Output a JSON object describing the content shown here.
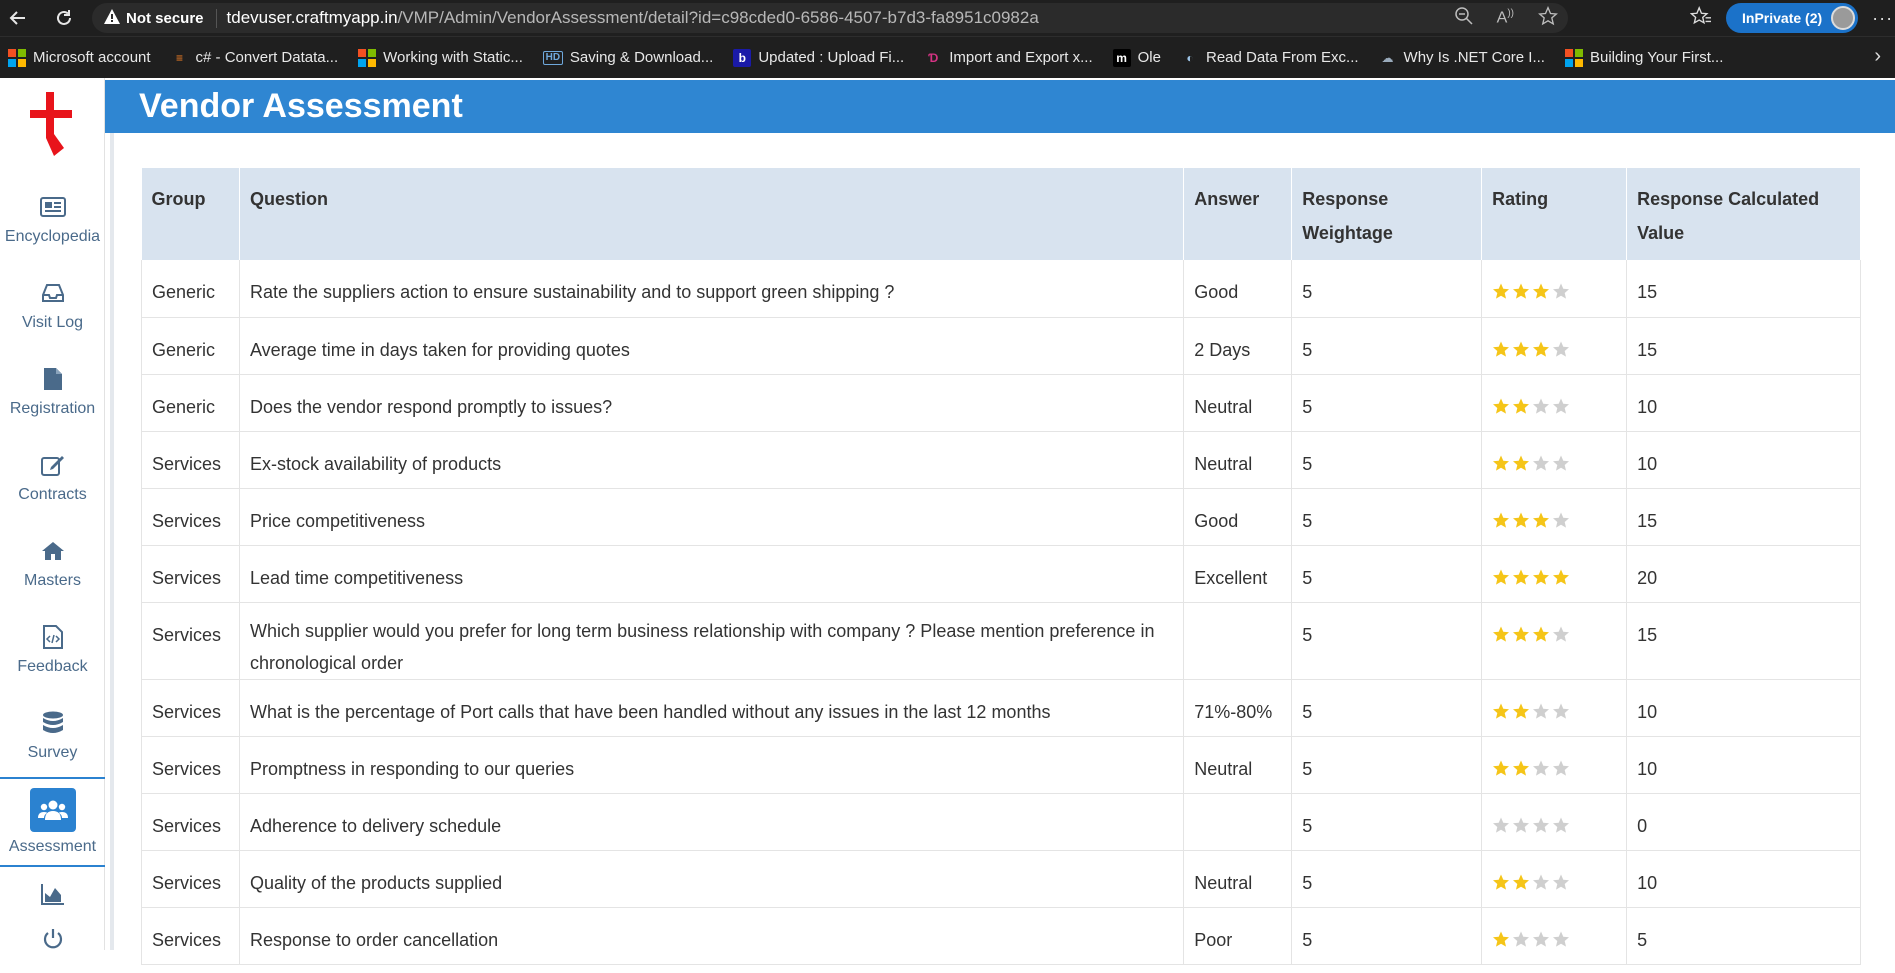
{
  "browser": {
    "not_secure": "Not secure",
    "url_host": "tdevuser.craftmyapp.in",
    "url_path": "/VMP/Admin/VendorAssessment/detail?id=c98cded0-6586-4507-b7d3-fa8951c0982a",
    "profile_label": "InPrivate (2)",
    "bookmarks": [
      {
        "label": "Microsoft account",
        "icon": "microsoft-icon"
      },
      {
        "label": "c# - Convert Datata...",
        "icon": "stackoverflow-icon"
      },
      {
        "label": "Working with Static...",
        "icon": "microsoft-icon"
      },
      {
        "label": "Saving & Download...",
        "icon": "hd-icon"
      },
      {
        "label": "Updated : Upload Fi...",
        "icon": "b-icon"
      },
      {
        "label": "Import and Export x...",
        "icon": "d-icon"
      },
      {
        "label": "Ole",
        "icon": "m-icon"
      },
      {
        "label": "Read Data From Exc...",
        "icon": "globe-icon"
      },
      {
        "label": "Why Is .NET Core I...",
        "icon": "cloud-icon"
      },
      {
        "label": "Building Your First...",
        "icon": "microsoft-icon"
      }
    ]
  },
  "sidebar": {
    "items": [
      {
        "label": "Encyclopedia",
        "icon": "newspaper-icon"
      },
      {
        "label": "Visit Log",
        "icon": "inbox-icon"
      },
      {
        "label": "Registration",
        "icon": "file-icon"
      },
      {
        "label": "Contracts",
        "icon": "edit-icon"
      },
      {
        "label": "Masters",
        "icon": "home-icon"
      },
      {
        "label": "Feedback",
        "icon": "code-file-icon"
      },
      {
        "label": "Survey",
        "icon": "database-icon"
      },
      {
        "label": "Assessment",
        "icon": "users-icon"
      }
    ],
    "active": "Assessment"
  },
  "header": {
    "title": "Vendor Assessment"
  },
  "table": {
    "columns": [
      "Group",
      "Question",
      "Answer",
      "Response Weightage",
      "Rating",
      "Response Calculated Value"
    ],
    "rows": [
      {
        "group": "Generic",
        "question": "Rate the suppliers action to ensure sustainability and to support green shipping ?",
        "answer": "Good",
        "weightage": "5",
        "rating": 3,
        "value": "15"
      },
      {
        "group": "Generic",
        "question": "Average time in days taken for providing quotes",
        "answer": "2 Days",
        "weightage": "5",
        "rating": 3,
        "value": "15"
      },
      {
        "group": "Generic",
        "question": "Does the vendor respond promptly to issues?",
        "answer": "Neutral",
        "weightage": "5",
        "rating": 2,
        "value": "10"
      },
      {
        "group": "Services",
        "question": "Ex-stock availability of products",
        "answer": "Neutral",
        "weightage": "5",
        "rating": 2,
        "value": "10"
      },
      {
        "group": "Services",
        "question": "Price competitiveness",
        "answer": "Good",
        "weightage": "5",
        "rating": 3,
        "value": "15"
      },
      {
        "group": "Services",
        "question": "Lead time competitiveness",
        "answer": "Excellent",
        "weightage": "5",
        "rating": 4,
        "value": "20"
      },
      {
        "group": "Services",
        "question": "Which supplier would you prefer for long term business relationship with company ? Please mention preference in chronological order",
        "answer": "",
        "weightage": "5",
        "rating": 3,
        "value": "15"
      },
      {
        "group": "Services",
        "question": "What is the percentage of Port calls that have been handled without any issues in the last 12 months",
        "answer": "71%-80%",
        "weightage": "5",
        "rating": 2,
        "value": "10"
      },
      {
        "group": "Services",
        "question": "Promptness in responding to our queries",
        "answer": "Neutral",
        "weightage": "5",
        "rating": 2,
        "value": "10"
      },
      {
        "group": "Services",
        "question": "Adherence to delivery schedule",
        "answer": "",
        "weightage": "5",
        "rating": 0,
        "value": "0"
      },
      {
        "group": "Services",
        "question": "Quality of the products supplied",
        "answer": "Neutral",
        "weightage": "5",
        "rating": 2,
        "value": "10"
      },
      {
        "group": "Services",
        "question": "Response to order cancellation",
        "answer": "Poor",
        "weightage": "5",
        "rating": 1,
        "value": "5"
      }
    ],
    "star_max": 4,
    "star_color": "#f5c518",
    "star_empty_color": "#cfcfcf"
  }
}
